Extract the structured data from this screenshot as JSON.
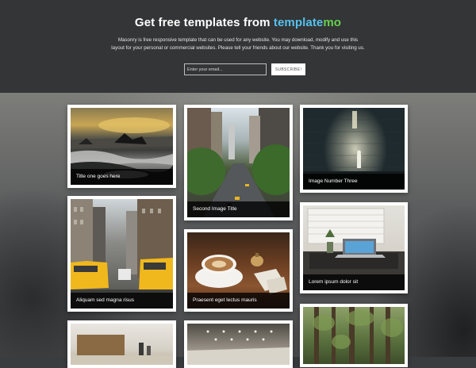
{
  "header": {
    "title_prefix": "Get free templates from ",
    "brand_part1": "template",
    "brand_part2": "mo",
    "tagline": "Masonry is free responsive template that can be used for any website. You may download, modify and use this layout for your personal or commercial websites. Please tell your friends about our website. Thank you for visiting us.",
    "email_placeholder": "Enter your email...",
    "subscribe_label": "SUBSCRIBE!"
  },
  "gallery": [
    {
      "caption": "Title one goes here",
      "image": "seascape-rocks-sunset"
    },
    {
      "caption": "Second Image Title",
      "image": "city-street-trees"
    },
    {
      "caption": "Image Number Three",
      "image": "person-lit-wall"
    },
    {
      "caption": "Aliquam sed magna risus",
      "image": "new-york-taxis"
    },
    {
      "caption": "Praesent eget lectus mauris",
      "image": "coffee-cup-bell"
    },
    {
      "caption": "Lorem ipsum dolor sit",
      "image": "laptop-desk-window"
    },
    {
      "caption": "",
      "image": "cafe-tables"
    },
    {
      "caption": "",
      "image": "ceiling-interior"
    },
    {
      "caption": "",
      "image": "forest-trees"
    }
  ],
  "colors": {
    "header_bg": "#333536",
    "brand_blue": "#55c1ef",
    "brand_green": "#67d14f",
    "caption_bg": "#000000"
  }
}
